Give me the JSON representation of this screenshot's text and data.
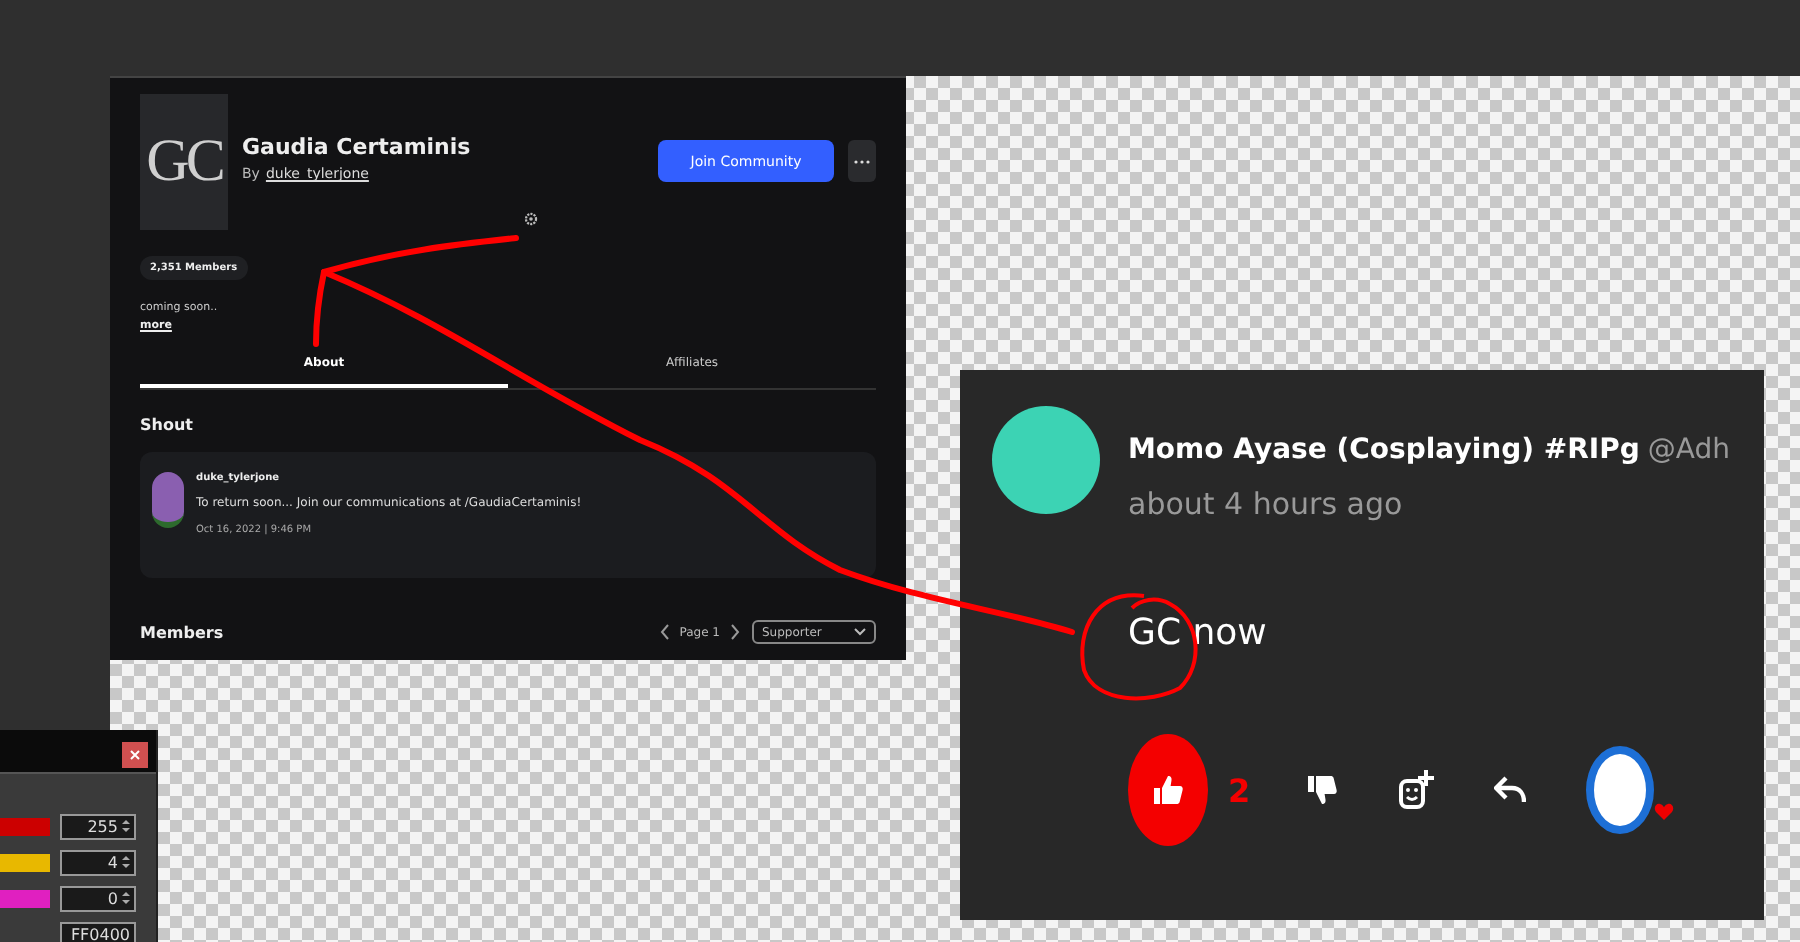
{
  "community": {
    "logo_text": "GC",
    "name": "Gaudia Certaminis",
    "by_label": "By",
    "owner": "duke_tylerjone",
    "join_button": "Join Community",
    "members_badge": "2,351 Members",
    "description": "coming soon..",
    "more_link": "more",
    "tabs": [
      {
        "label": "About",
        "selected": true
      },
      {
        "label": "Affiliates",
        "selected": false
      }
    ],
    "shout_heading": "Shout",
    "shout": {
      "author": "duke_tylerjone",
      "text": "To return soon... Join our communications at /GaudiaCertaminis!",
      "timestamp": "Oct 16, 2022 | 9:46 PM"
    },
    "members_heading": "Members",
    "page_label": "Page 1",
    "role_select": "Supporter"
  },
  "comment": {
    "author": "Momo Ayase (Cosplaying) #RIPg",
    "handle": "@Adh",
    "time": "about 4 hours ago",
    "text": "GC now",
    "likes": "2",
    "liked": true
  },
  "color_panel": {
    "channels": [
      {
        "value": "255",
        "color": "#cc0000"
      },
      {
        "value": "4",
        "color": "#e8b800"
      },
      {
        "value": "0",
        "color": "#e020c0"
      }
    ],
    "hex": "FF0400"
  }
}
